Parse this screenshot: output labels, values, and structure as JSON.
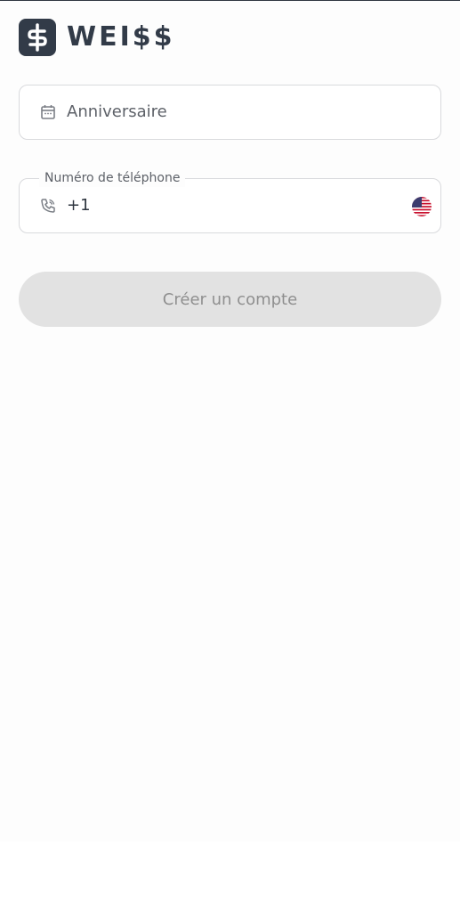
{
  "brand": {
    "name": "WEI$$",
    "mark_icon": "dollar-icon",
    "color": "#323b48"
  },
  "form": {
    "birthday": {
      "placeholder": "Anniversaire",
      "icon": "calendar-icon"
    },
    "phone": {
      "label": "Numéro de téléphone",
      "value": "+1",
      "icon": "phone-icon",
      "country_flag": "us-flag-icon"
    }
  },
  "actions": {
    "create_account_label": "Créer un compte",
    "button_bg": "#e2e2e2"
  }
}
